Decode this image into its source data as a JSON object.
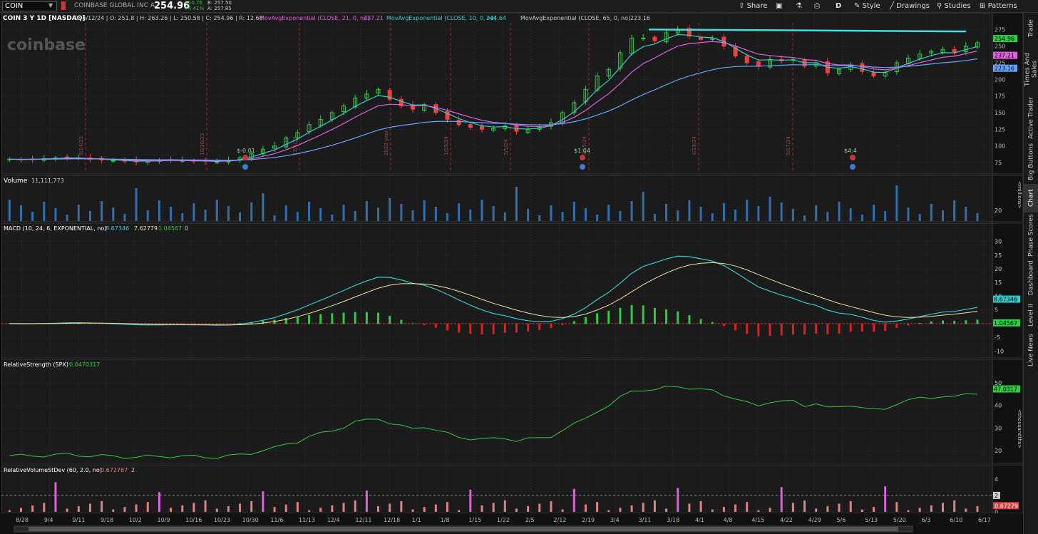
{
  "toolbar": {
    "symbol": "COIN",
    "company": "COINBASE GLOBAL INC A",
    "last": "254.96",
    "change": "+10.76",
    "change_pct": "+4.41%",
    "bid": "B: 257.50",
    "ask": "A: 257.85",
    "share_label": "Share",
    "style_label": "Style",
    "drawings_label": "Drawings",
    "studies_label": "Studies",
    "patterns_label": "Patterns",
    "interval_label": "D"
  },
  "sidebar_tabs": [
    "Trade",
    "Times And Sales",
    "Active Trader",
    "Big Buttons",
    "Chart",
    "Phase Scores",
    "Dashboard",
    "Level II",
    "Live News"
  ],
  "price_panel": {
    "title": "COIN 3 Y 1D [NASDAQ]",
    "ohlc": "D: 6/12/24 | O: 251.8 | H: 263.26 | L: 250.58 | C: 254.96 | R: 12.68",
    "ma21_label": "MovAvgExponential (CLOSE, 21, 0, no)",
    "ma21_value": "237.21",
    "ma10_label": "MovAvgExponential (CLOSE, 10, 0, no)",
    "ma10_value": "244.64",
    "ma65_label": "MovAvgExponential (CLOSE, 65, 0, no)",
    "ma65_value": "223.16",
    "watermark": "coinbase",
    "axis_ticks": [
      "275",
      "250",
      "225",
      "200",
      "175",
      "150",
      "125",
      "100",
      "75"
    ],
    "price_badges": [
      "254.96",
      "237.21",
      "223.16"
    ],
    "earnings_labels": [
      "$-0.01",
      "$1.04",
      "$4.4"
    ],
    "date_markers": [
      "9/14/23",
      "10/20/23",
      "12/1/23",
      "2023 year",
      "1/19/24",
      "3/1/24",
      "3/15/24",
      "4/19/24",
      "5/17/24"
    ],
    "colors": {
      "up": "#2ecc40",
      "down": "#f04040",
      "ma10": "#33cccc",
      "ma21": "#e060e0",
      "ma65": "#66a3ff",
      "resistance": "#40e0e0"
    }
  },
  "volume_panel": {
    "title": "Volume",
    "value": "11,111,773",
    "axis_ticks": [
      "20"
    ],
    "unit": "<millions>"
  },
  "macd_panel": {
    "title": "MACD (10, 24, 6, EXPONENTIAL, no)",
    "value": "8.67346",
    "avg": "7.62779",
    "diff": "1.04567",
    "zero": "0",
    "axis_ticks": [
      "30",
      "25",
      "20",
      "15",
      "10",
      "5",
      "0",
      "-5",
      "-10"
    ],
    "badges": [
      "8.67346",
      "1.04567"
    ]
  },
  "rs_panel": {
    "title": "RelativeStrength (SPX)",
    "value": "0.0470317",
    "axis_ticks": [
      "50",
      "40",
      "30",
      "20"
    ],
    "badge": "47.0317",
    "unit": "<thousandths>"
  },
  "rv_panel": {
    "title": "RelativeVolumeStDev (60, 2.0, no)",
    "value": "0.672787",
    "level": "2",
    "axis_ticks": [
      "4",
      "2",
      "0"
    ],
    "badge": "0.67279",
    "level_badge": "2"
  },
  "x_axis_labels": [
    "8/28",
    "9/4",
    "9/11",
    "9/18",
    "10/2",
    "10/9",
    "10/16",
    "10/23",
    "10/30",
    "11/6",
    "11/13",
    "12/4",
    "12/11",
    "12/18",
    "1/1",
    "1/8",
    "1/15",
    "1/22",
    "2/5",
    "2/12",
    "2/19",
    "3/4",
    "3/11",
    "3/18",
    "4/1",
    "4/8",
    "4/15",
    "4/22",
    "4/29",
    "5/6",
    "5/13",
    "5/20",
    "6/3",
    "6/10",
    "6/17"
  ],
  "chart_data": {
    "type": "candlestick",
    "y_range": [
      60,
      285
    ],
    "approx_closes": [
      80,
      79,
      80,
      81,
      82,
      83,
      82,
      80,
      79,
      78,
      77,
      76,
      77,
      78,
      79,
      78,
      77,
      77,
      76,
      78,
      82,
      88,
      95,
      100,
      112,
      120,
      132,
      140,
      150,
      160,
      172,
      178,
      185,
      170,
      160,
      155,
      162,
      150,
      140,
      132,
      128,
      125,
      126,
      130,
      122,
      125,
      128,
      135,
      150,
      165,
      185,
      205,
      215,
      240,
      262,
      262,
      258,
      270,
      275,
      265,
      260,
      262,
      250,
      235,
      225,
      220,
      230,
      228,
      230,
      220,
      225,
      210,
      215,
      222,
      212,
      205,
      210,
      225,
      232,
      238,
      242,
      245,
      240,
      250,
      255
    ],
    "resistance_level": 272,
    "macd_range": [
      -12,
      33
    ],
    "rs_range": [
      15,
      56
    ],
    "rv_range": [
      0,
      4.5
    ]
  }
}
